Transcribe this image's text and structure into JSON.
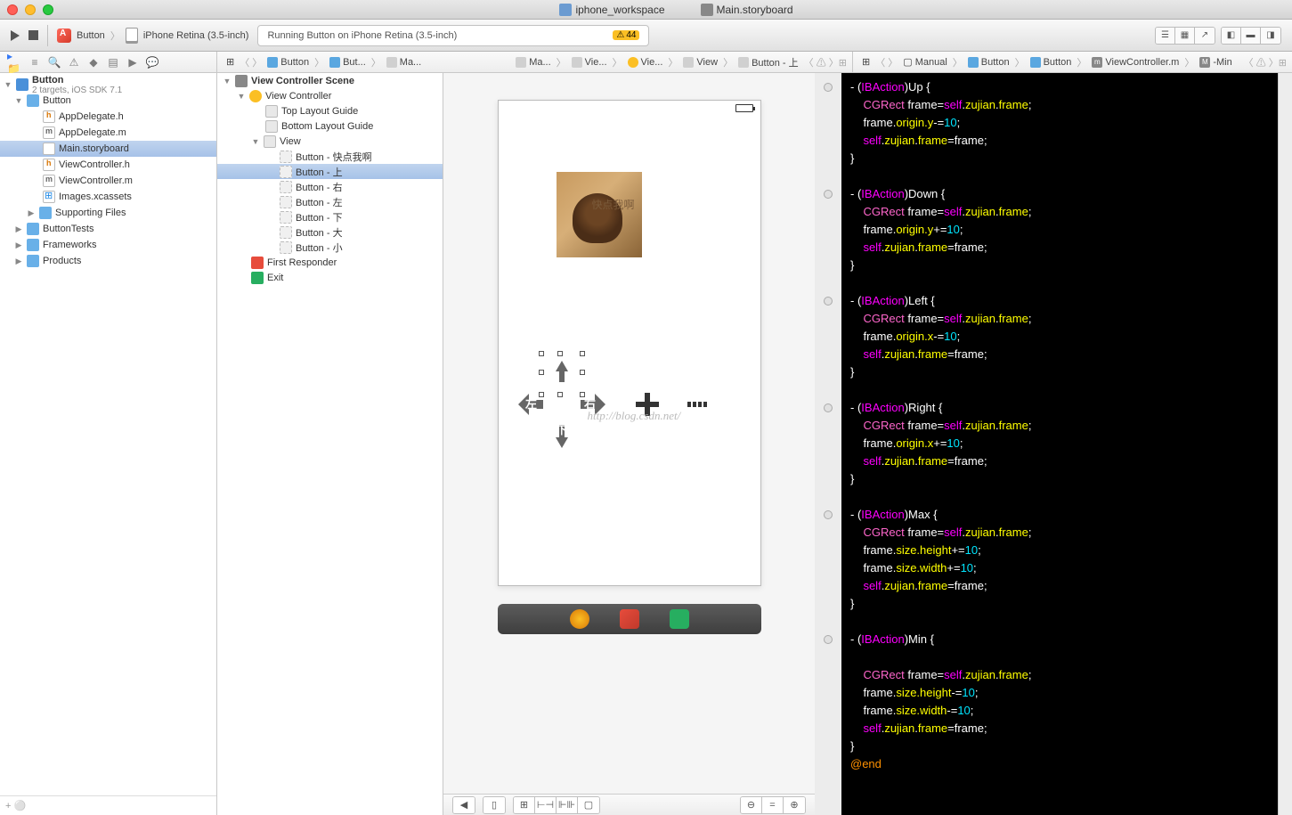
{
  "titlebar": {
    "workspace_label": "iphone_workspace",
    "storyboard_label": "Main.storyboard"
  },
  "toolbar": {
    "scheme_app": "Button",
    "scheme_device": "iPhone Retina (3.5-inch)",
    "activity_text": "Running Button on iPhone Retina (3.5-inch)",
    "warning_count": "44"
  },
  "jumpbar_left": [
    "Button",
    "But...",
    "Ma..."
  ],
  "jumpbar_right": [
    "Ma...",
    "Vie...",
    "Vie...",
    "View",
    "Button - 上"
  ],
  "jumpbar_code_left": [
    "Manual",
    "Button",
    "Button",
    "ViewController.m",
    "-Min"
  ],
  "navigator": {
    "project": "Button",
    "project_sub": "2 targets, iOS SDK 7.1",
    "folder": "Button",
    "files": [
      "AppDelegate.h",
      "AppDelegate.m",
      "Main.storyboard",
      "ViewController.h",
      "ViewController.m",
      "Images.xcassets"
    ],
    "supporting": "Supporting Files",
    "others": [
      "ButtonTests",
      "Frameworks",
      "Products"
    ]
  },
  "outline": {
    "scene": "View Controller Scene",
    "vc": "View Controller",
    "top_guide": "Top Layout Guide",
    "bottom_guide": "Bottom Layout Guide",
    "view": "View",
    "buttons": [
      "Button - 快点我啊",
      "Button - 上",
      "Button - 右",
      "Button - 左",
      "Button - 下",
      "Button - 大",
      "Button - 小"
    ],
    "first_responder": "First Responder",
    "exit": "Exit"
  },
  "canvas": {
    "img_text": "快点我啊",
    "dpad": {
      "up": "上",
      "left": "左",
      "right": "右",
      "down": "下"
    },
    "watermark": "http://blog.csdn.net/"
  },
  "code": {
    "methods": [
      {
        "name": "Up",
        "body_prop": "origin.y",
        "op": "-=",
        "val": "10"
      },
      {
        "name": "Down",
        "body_prop": "origin.y",
        "op": "+=",
        "val": "10"
      },
      {
        "name": "Left",
        "body_prop": "origin.x",
        "op": "-=",
        "val": "10"
      },
      {
        "name": "Right",
        "body_prop": "origin.x",
        "op": "+=",
        "val": "10"
      }
    ],
    "max": {
      "name": "Max",
      "p1": "size.height",
      "p2": "size.width",
      "op": "+=",
      "v": "10"
    },
    "min": {
      "name": "Min",
      "p1": "size.height",
      "p2": "size.width",
      "op": "-=",
      "v": "10"
    },
    "end": "@end"
  }
}
